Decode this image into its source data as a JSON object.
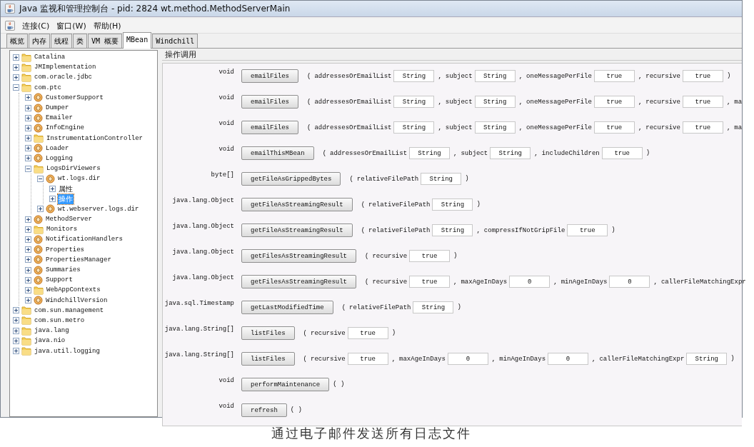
{
  "window": {
    "title": "Java 监视和管理控制台 - pid: 2824 wt.method.MethodServerMain"
  },
  "menu": [
    "连接(C)",
    "窗口(W)",
    "帮助(H)"
  ],
  "tabs": [
    {
      "label": "概览",
      "selected": false
    },
    {
      "label": "内存",
      "selected": false
    },
    {
      "label": "线程",
      "selected": false
    },
    {
      "label": "类",
      "selected": false
    },
    {
      "label": "VM 概要",
      "selected": false
    },
    {
      "label": "MBean",
      "selected": true
    },
    {
      "label": "Windchill",
      "selected": false
    }
  ],
  "tree": [
    {
      "label": "Catalina",
      "kind": "folder",
      "expanded": false,
      "selected": false
    },
    {
      "label": "JMImplementation",
      "kind": "folder",
      "expanded": false,
      "selected": false
    },
    {
      "label": "com.oracle.jdbc",
      "kind": "folder",
      "expanded": false,
      "selected": false
    },
    {
      "label": "com.ptc",
      "kind": "folder",
      "expanded": true,
      "selected": false,
      "children": [
        {
          "label": "CustomerSupport",
          "kind": "bean",
          "expanded": false,
          "selected": false
        },
        {
          "label": "Dumper",
          "kind": "bean",
          "expanded": false,
          "selected": false
        },
        {
          "label": "Emailer",
          "kind": "bean",
          "expanded": false,
          "selected": false
        },
        {
          "label": "InfoEngine",
          "kind": "bean",
          "expanded": false,
          "selected": false
        },
        {
          "label": "InstrumentationController",
          "kind": "folder",
          "expanded": false,
          "selected": false
        },
        {
          "label": "Loader",
          "kind": "bean",
          "expanded": false,
          "selected": false
        },
        {
          "label": "Logging",
          "kind": "bean",
          "expanded": false,
          "selected": false
        },
        {
          "label": "LogsDirViewers",
          "kind": "folder",
          "expanded": true,
          "selected": false,
          "children": [
            {
              "label": "wt.logs.dir",
              "kind": "bean",
              "expanded": true,
              "selected": false,
              "children": [
                {
                  "label": "属性",
                  "expanded": false,
                  "selected": false
                },
                {
                  "label": "操作",
                  "expanded": false,
                  "selected": true
                }
              ]
            },
            {
              "label": "wt.webserver.logs.dir",
              "kind": "bean",
              "expanded": false,
              "selected": false
            }
          ]
        },
        {
          "label": "MethodServer",
          "kind": "bean",
          "expanded": false,
          "selected": false
        },
        {
          "label": "Monitors",
          "kind": "folder",
          "expanded": false,
          "selected": false
        },
        {
          "label": "NotificationHandlers",
          "kind": "bean",
          "expanded": false,
          "selected": false
        },
        {
          "label": "Properties",
          "kind": "bean",
          "expanded": false,
          "selected": false
        },
        {
          "label": "PropertiesManager",
          "kind": "bean",
          "expanded": false,
          "selected": false
        },
        {
          "label": "Summaries",
          "kind": "bean",
          "expanded": false,
          "selected": false
        },
        {
          "label": "Support",
          "kind": "bean",
          "expanded": false,
          "selected": false
        },
        {
          "label": "WebAppContexts",
          "kind": "folder",
          "expanded": false,
          "selected": false
        },
        {
          "label": "WindchillVersion",
          "kind": "bean",
          "expanded": false,
          "selected": false
        }
      ]
    },
    {
      "label": "com.sun.management",
      "kind": "folder",
      "expanded": false,
      "selected": false
    },
    {
      "label": "com.sun.metro",
      "kind": "folder",
      "expanded": false,
      "selected": false
    },
    {
      "label": "java.lang",
      "kind": "folder",
      "expanded": false,
      "selected": false
    },
    {
      "label": "java.nio",
      "kind": "folder",
      "expanded": false,
      "selected": false
    },
    {
      "label": "java.util.logging",
      "kind": "folder",
      "expanded": false,
      "selected": false
    }
  ],
  "operations": {
    "title": "操作调用",
    "rows": [
      {
        "return_type": "void",
        "method": "emailFiles",
        "params": [
          {
            "sep": "(",
            "label": "addressesOrEmailList",
            "value": "String"
          },
          {
            "sep": ",",
            "label": "subject",
            "value": "String"
          },
          {
            "sep": ",",
            "label": "oneMessagePerFile",
            "value": "true"
          },
          {
            "sep": ",",
            "label": "recursive",
            "value": "true"
          }
        ],
        "close": ")"
      },
      {
        "return_type": "void",
        "method": "emailFiles",
        "params": [
          {
            "sep": "(",
            "label": "addressesOrEmailList",
            "value": "String"
          },
          {
            "sep": ",",
            "label": "subject",
            "value": "String"
          },
          {
            "sep": ",",
            "label": "oneMessagePerFile",
            "value": "true"
          },
          {
            "sep": ",",
            "label": "recursive",
            "value": "true"
          },
          {
            "sep": ",",
            "label": "ma"
          }
        ]
      },
      {
        "return_type": "void",
        "method": "emailFiles",
        "params": [
          {
            "sep": "(",
            "label": "addressesOrEmailList",
            "value": "String"
          },
          {
            "sep": ",",
            "label": "subject",
            "value": "String"
          },
          {
            "sep": ",",
            "label": "oneMessagePerFile",
            "value": "true"
          },
          {
            "sep": ",",
            "label": "recursive",
            "value": "true"
          },
          {
            "sep": ",",
            "label": "ma"
          }
        ]
      },
      {
        "return_type": "void",
        "method": "emailThisMBean",
        "params": [
          {
            "sep": "(",
            "label": "addressesOrEmailList",
            "value": "String"
          },
          {
            "sep": ",",
            "label": "subject",
            "value": "String"
          },
          {
            "sep": ",",
            "label": "includeChildren",
            "value": "true"
          }
        ],
        "close": ")"
      },
      {
        "return_type": "byte[]",
        "method": "getFileAsGrippedBytes",
        "params": [
          {
            "sep": "(",
            "label": "relativeFilePath",
            "value": "String"
          }
        ],
        "close": ")"
      },
      {
        "return_type": "java.lang.Object",
        "method": "getFileAsStreamingResult",
        "params": [
          {
            "sep": "(",
            "label": "relativeFilePath",
            "value": "String"
          }
        ],
        "close": ")"
      },
      {
        "return_type": "java.lang.Object",
        "method": "getFileAsStreamingResult",
        "params": [
          {
            "sep": "(",
            "label": "relativeFilePath",
            "value": "String"
          },
          {
            "sep": ",",
            "label": "compressIfNotGripFile",
            "value": "true"
          }
        ],
        "close": ")"
      },
      {
        "return_type": "java.lang.Object",
        "method": "getFilesAsStreamingResult",
        "params": [
          {
            "sep": "(",
            "label": "recursive",
            "value": "true"
          }
        ],
        "close": ")"
      },
      {
        "return_type": "java.lang.Object",
        "method": "getFilesAsStreamingResult",
        "params": [
          {
            "sep": "(",
            "label": "recursive",
            "value": "true"
          },
          {
            "sep": ",",
            "label": "maxAgeInDays",
            "value": "0"
          },
          {
            "sep": ",",
            "label": "minAgeInDays",
            "value": "0"
          },
          {
            "sep": ",",
            "label": "callerFileMatchingExpr"
          }
        ]
      },
      {
        "return_type": "java.sql.Timestamp",
        "method": "getLastModifiedTime",
        "params": [
          {
            "sep": "(",
            "label": "relativeFilePath",
            "value": "String"
          }
        ],
        "close": ")"
      },
      {
        "return_type": "java.lang.String[]",
        "method": "listFiles",
        "params": [
          {
            "sep": "(",
            "label": "recursive",
            "value": "true"
          }
        ],
        "close": ")"
      },
      {
        "return_type": "java.lang.String[]",
        "method": "listFiles",
        "params": [
          {
            "sep": "(",
            "label": "recursive",
            "value": "true"
          },
          {
            "sep": ",",
            "label": "maxAgeInDays",
            "value": "0"
          },
          {
            "sep": ",",
            "label": "minAgeInDays",
            "value": "0"
          },
          {
            "sep": ",",
            "label": "callerFileMatchingExpr",
            "value": "String"
          }
        ],
        "close": ")"
      },
      {
        "return_type": "void",
        "method": "performMaintenance",
        "params": [],
        "close": "( )"
      },
      {
        "return_type": "void",
        "method": "refresh",
        "params": [],
        "close": "( )"
      }
    ]
  },
  "caption": "通过电子邮件发送所有日志文件"
}
